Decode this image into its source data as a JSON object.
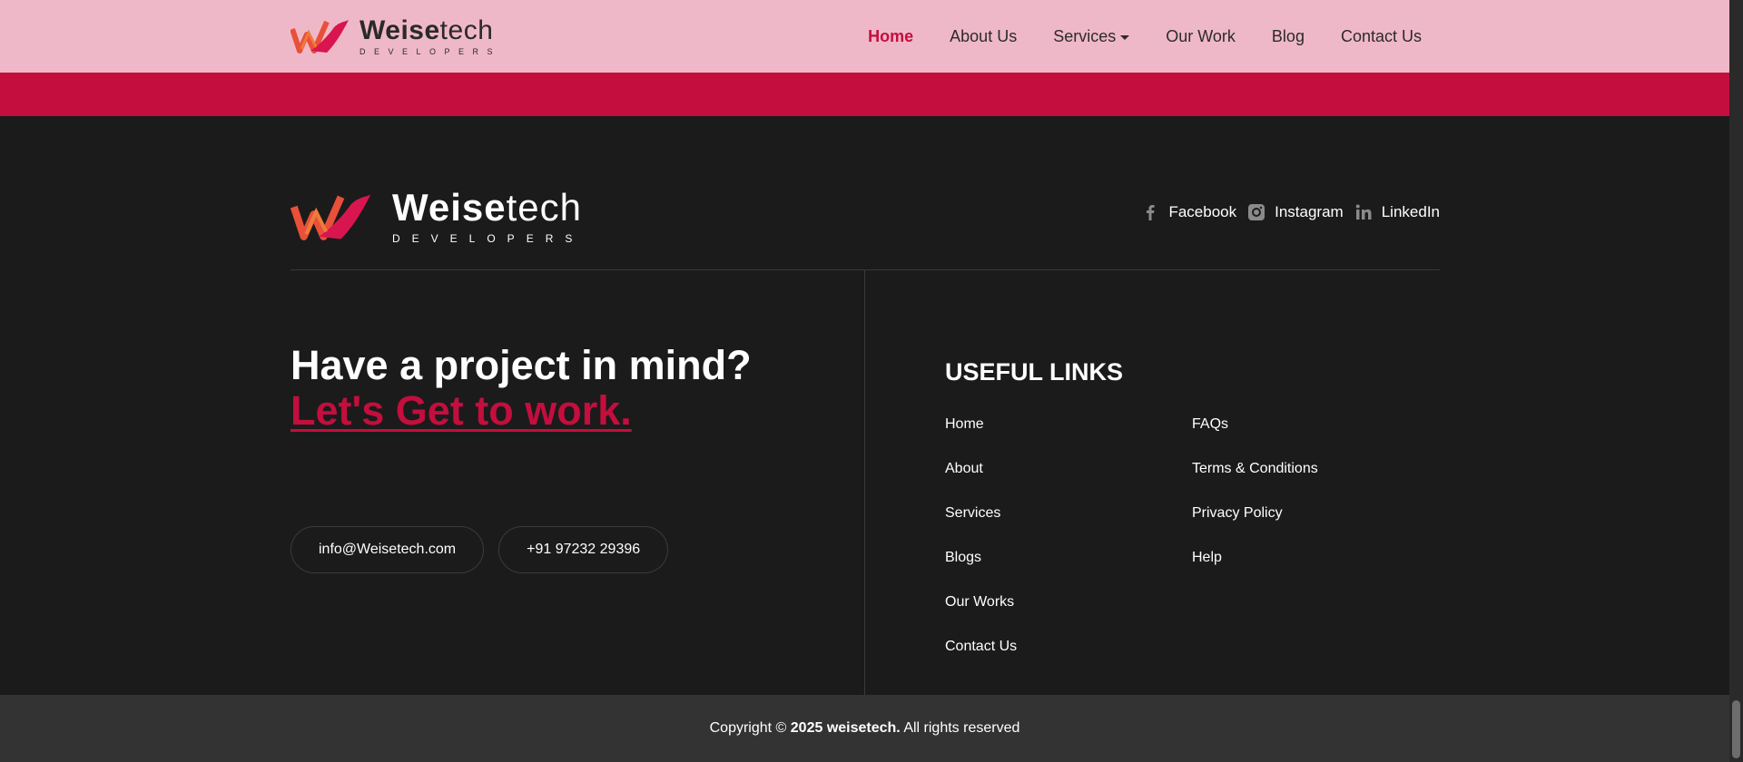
{
  "brand": {
    "name_bold": "Weise",
    "name_light": "tech",
    "tagline": "DEVELOPERS"
  },
  "nav": {
    "items": [
      {
        "label": "Home"
      },
      {
        "label": "About Us"
      },
      {
        "label": "Services"
      },
      {
        "label": "Our Work"
      },
      {
        "label": "Blog"
      },
      {
        "label": "Contact Us"
      }
    ]
  },
  "colors": {
    "accent": "#c30e3e",
    "header_bg": "#efb8c8",
    "footer_bg": "#1b1b1b",
    "bottom_bg": "#333333"
  },
  "social": [
    {
      "label": "Facebook",
      "icon": "facebook-icon"
    },
    {
      "label": "Instagram",
      "icon": "instagram-icon"
    },
    {
      "label": "LinkedIn",
      "icon": "linkedin-icon"
    }
  ],
  "cta": {
    "title": "Have a project in mind?",
    "link": "Let's Get to work."
  },
  "contact": {
    "email": "info@Weisetech.com",
    "phone": "+91 97232 29396"
  },
  "useful_links": {
    "title": "USEFUL LINKS",
    "col1": [
      "Home",
      "About",
      "Services",
      "Blogs",
      "Our Works",
      "Contact Us"
    ],
    "col2": [
      "FAQs",
      "Terms & Conditions",
      "Privacy Policy",
      "Help"
    ]
  },
  "copyright": {
    "prefix": "Copyright © ",
    "bold": "2025 weisetech.",
    "suffix": " All rights reserved"
  }
}
